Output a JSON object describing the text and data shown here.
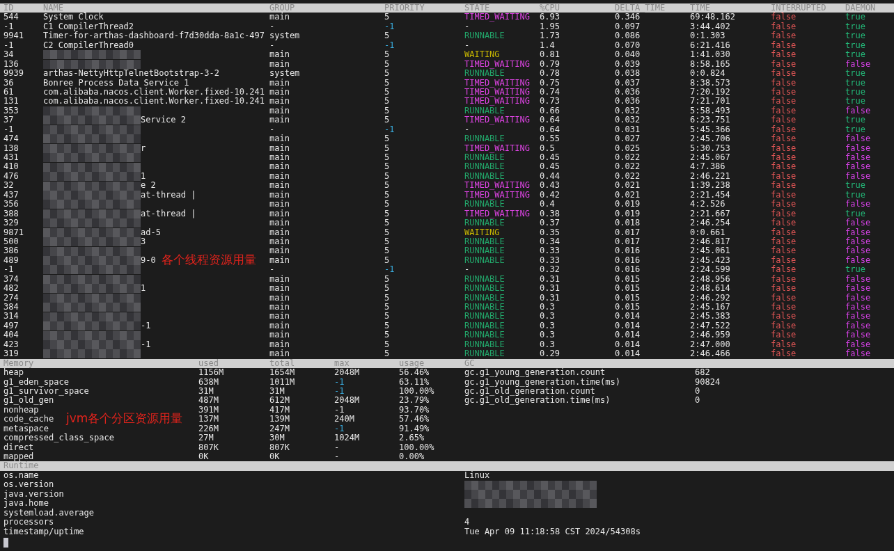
{
  "threads": {
    "columns": [
      "ID",
      "NAME",
      "GROUP",
      "PRIORITY",
      "STATE",
      "%CPU",
      "DELTA_TIME",
      "TIME",
      "INTERRUPTED",
      "DAEMON"
    ],
    "rows": [
      {
        "id": "544",
        "name": "System Clock",
        "redacted": false,
        "group": "main",
        "priority": "5",
        "internal": false,
        "state": {
          "text": "TIMED_WAITING",
          "color": "#e044e6"
        },
        "cpu": "6.93",
        "delta": "0.346",
        "time": "69:48.162",
        "interrupted": "false",
        "daemon": {
          "text": "true",
          "color": "#23b878"
        }
      },
      {
        "id": "-1",
        "name": "C1 CompilerThread2",
        "redacted": false,
        "group": "-",
        "priority": "-1",
        "internal": true,
        "state": {
          "text": "-"
        },
        "cpu": "1.95",
        "delta": "0.097",
        "time": "3:44.402",
        "interrupted": "false",
        "daemon": {
          "text": "true",
          "color": "#23b878"
        }
      },
      {
        "id": "9941",
        "name": "Timer-for-arthas-dashboard-f7d30dda-8a1c-497",
        "redacted": false,
        "group": "system",
        "priority": "5",
        "internal": false,
        "state": {
          "text": "RUNNABLE",
          "color": "#22a66a"
        },
        "cpu": "1.73",
        "delta": "0.086",
        "time": "0:1.303",
        "interrupted": "false",
        "daemon": {
          "text": "true",
          "color": "#23b878"
        }
      },
      {
        "id": "-1",
        "name": "C2 CompilerThread0",
        "redacted": false,
        "group": "-",
        "priority": "-1",
        "internal": true,
        "state": {
          "text": "-"
        },
        "cpu": "1.4",
        "delta": "0.070",
        "time": "6:21.416",
        "interrupted": "false",
        "daemon": {
          "text": "true",
          "color": "#23b878"
        }
      },
      {
        "id": "34",
        "redacted": true,
        "group": "main",
        "priority": "5",
        "internal": false,
        "state": {
          "text": "WAITING",
          "color": "#c9b800"
        },
        "cpu": "0.81",
        "delta": "0.040",
        "time": "1:41.030",
        "interrupted": "false",
        "daemon": {
          "text": "true",
          "color": "#23b878"
        }
      },
      {
        "id": "136",
        "redacted": true,
        "group": "main",
        "priority": "5",
        "internal": false,
        "state": {
          "text": "TIMED_WAITING",
          "color": "#e044e6"
        },
        "cpu": "0.79",
        "delta": "0.039",
        "time": "8:58.165",
        "interrupted": "false",
        "daemon": {
          "text": "false",
          "color": "#d040e0"
        }
      },
      {
        "id": "9939",
        "name": "arthas-NettyHttpTelnetBootstrap-3-2",
        "redacted": false,
        "group": "system",
        "priority": "5",
        "internal": false,
        "state": {
          "text": "RUNNABLE",
          "color": "#22a66a"
        },
        "cpu": "0.78",
        "delta": "0.038",
        "time": "0:0.824",
        "interrupted": "false",
        "daemon": {
          "text": "true",
          "color": "#23b878"
        }
      },
      {
        "id": "36",
        "name": "Bonree Process Data Service 1",
        "redacted": false,
        "group": "main",
        "priority": "5",
        "internal": false,
        "state": {
          "text": "TIMED_WAITING",
          "color": "#e044e6"
        },
        "cpu": "0.75",
        "delta": "0.037",
        "time": "8:38.573",
        "interrupted": "false",
        "daemon": {
          "text": "true",
          "color": "#23b878"
        }
      },
      {
        "id": "61",
        "name": "com.alibaba.nacos.client.Worker.fixed-10.241",
        "redacted": false,
        "group": "main",
        "priority": "5",
        "internal": false,
        "state": {
          "text": "TIMED_WAITING",
          "color": "#e044e6"
        },
        "cpu": "0.74",
        "delta": "0.036",
        "time": "7:20.192",
        "interrupted": "false",
        "daemon": {
          "text": "true",
          "color": "#23b878"
        }
      },
      {
        "id": "131",
        "name": "com.alibaba.nacos.client.Worker.fixed-10.241",
        "redacted": false,
        "group": "main",
        "priority": "5",
        "internal": false,
        "state": {
          "text": "TIMED_WAITING",
          "color": "#e044e6"
        },
        "cpu": "0.73",
        "delta": "0.036",
        "time": "7:21.701",
        "interrupted": "false",
        "daemon": {
          "text": "true",
          "color": "#23b878"
        }
      },
      {
        "id": "353",
        "redacted": true,
        "group": "main",
        "priority": "5",
        "internal": false,
        "state": {
          "text": "RUNNABLE",
          "color": "#22a66a"
        },
        "cpu": "0.66",
        "delta": "0.032",
        "time": "5:58.493",
        "interrupted": "false",
        "daemon": {
          "text": "false",
          "color": "#d040e0"
        }
      },
      {
        "id": "37",
        "name": "Service 2",
        "redacted": true,
        "group": "main",
        "priority": "5",
        "internal": false,
        "state": {
          "text": "TIMED_WAITING",
          "color": "#e044e6"
        },
        "cpu": "0.64",
        "delta": "0.032",
        "time": "6:23.751",
        "interrupted": "false",
        "daemon": {
          "text": "true",
          "color": "#23b878"
        }
      },
      {
        "id": "-1",
        "redacted": true,
        "group": "-",
        "priority": "-1",
        "internal": true,
        "state": {
          "text": "-"
        },
        "cpu": "0.64",
        "delta": "0.031",
        "time": "5:45.366",
        "interrupted": "false",
        "daemon": {
          "text": "true",
          "color": "#23b878"
        }
      },
      {
        "id": "474",
        "redacted": true,
        "group": "main",
        "priority": "5",
        "internal": false,
        "state": {
          "text": "RUNNABLE",
          "color": "#22a66a"
        },
        "cpu": "0.55",
        "delta": "0.027",
        "time": "2:45.706",
        "interrupted": "false",
        "daemon": {
          "text": "false",
          "color": "#d040e0"
        }
      },
      {
        "id": "138",
        "name": "r",
        "redacted": true,
        "group": "main",
        "priority": "5",
        "internal": false,
        "state": {
          "text": "TIMED_WAITING",
          "color": "#e044e6"
        },
        "cpu": "0.5",
        "delta": "0.025",
        "time": "5:30.753",
        "interrupted": "false",
        "daemon": {
          "text": "false",
          "color": "#d040e0"
        }
      },
      {
        "id": "431",
        "redacted": true,
        "group": "main",
        "priority": "5",
        "internal": false,
        "state": {
          "text": "RUNNABLE",
          "color": "#22a66a"
        },
        "cpu": "0.45",
        "delta": "0.022",
        "time": "2:45.067",
        "interrupted": "false",
        "daemon": {
          "text": "false",
          "color": "#d040e0"
        }
      },
      {
        "id": "410",
        "redacted": true,
        "group": "main",
        "priority": "5",
        "internal": false,
        "state": {
          "text": "RUNNABLE",
          "color": "#22a66a"
        },
        "cpu": "0.45",
        "delta": "0.022",
        "time": "4:7.386",
        "interrupted": "false",
        "daemon": {
          "text": "false",
          "color": "#d040e0"
        }
      },
      {
        "id": "476",
        "name": "1",
        "redacted": true,
        "group": "main",
        "priority": "5",
        "internal": false,
        "state": {
          "text": "RUNNABLE",
          "color": "#22a66a"
        },
        "cpu": "0.44",
        "delta": "0.022",
        "time": "2:46.221",
        "interrupted": "false",
        "daemon": {
          "text": "false",
          "color": "#d040e0"
        }
      },
      {
        "id": "32",
        "name": "e 2",
        "redacted": true,
        "group": "main",
        "priority": "5",
        "internal": false,
        "state": {
          "text": "TIMED_WAITING",
          "color": "#e044e6"
        },
        "cpu": "0.43",
        "delta": "0.021",
        "time": "1:39.238",
        "interrupted": "false",
        "daemon": {
          "text": "true",
          "color": "#23b878"
        }
      },
      {
        "id": "437",
        "name": "at-thread |",
        "redacted": true,
        "group": "main",
        "priority": "5",
        "internal": false,
        "state": {
          "text": "TIMED_WAITING",
          "color": "#e044e6"
        },
        "cpu": "0.42",
        "delta": "0.021",
        "time": "2:21.454",
        "interrupted": "false",
        "daemon": {
          "text": "true",
          "color": "#23b878"
        }
      },
      {
        "id": "356",
        "redacted": true,
        "group": "main",
        "priority": "5",
        "internal": false,
        "state": {
          "text": "RUNNABLE",
          "color": "#22a66a"
        },
        "cpu": "0.4",
        "delta": "0.019",
        "time": "4:2.526",
        "interrupted": "false",
        "daemon": {
          "text": "false",
          "color": "#d040e0"
        }
      },
      {
        "id": "388",
        "name": "at-thread |",
        "redacted": true,
        "group": "main",
        "priority": "5",
        "internal": false,
        "state": {
          "text": "TIMED_WAITING",
          "color": "#e044e6"
        },
        "cpu": "0.38",
        "delta": "0.019",
        "time": "2:21.667",
        "interrupted": "false",
        "daemon": {
          "text": "true",
          "color": "#23b878"
        }
      },
      {
        "id": "329",
        "redacted": true,
        "group": "main",
        "priority": "5",
        "internal": false,
        "state": {
          "text": "RUNNABLE",
          "color": "#22a66a"
        },
        "cpu": "0.37",
        "delta": "0.018",
        "time": "2:46.254",
        "interrupted": "false",
        "daemon": {
          "text": "false",
          "color": "#d040e0"
        }
      },
      {
        "id": "9871",
        "name": "ad-5",
        "redacted": true,
        "group": "main",
        "priority": "5",
        "internal": false,
        "state": {
          "text": "WAITING",
          "color": "#c9b800"
        },
        "cpu": "0.35",
        "delta": "0.017",
        "time": "0:0.661",
        "interrupted": "false",
        "daemon": {
          "text": "false",
          "color": "#d040e0"
        }
      },
      {
        "id": "500",
        "name": "3",
        "redacted": true,
        "group": "main",
        "priority": "5",
        "internal": false,
        "state": {
          "text": "RUNNABLE",
          "color": "#22a66a"
        },
        "cpu": "0.34",
        "delta": "0.017",
        "time": "2:46.817",
        "interrupted": "false",
        "daemon": {
          "text": "false",
          "color": "#d040e0"
        }
      },
      {
        "id": "386",
        "redacted": true,
        "group": "main",
        "priority": "5",
        "internal": false,
        "state": {
          "text": "RUNNABLE",
          "color": "#22a66a"
        },
        "cpu": "0.33",
        "delta": "0.016",
        "time": "2:45.061",
        "interrupted": "false",
        "daemon": {
          "text": "false",
          "color": "#d040e0"
        }
      },
      {
        "id": "489",
        "name": "9-0",
        "redacted": true,
        "group": "main",
        "priority": "5",
        "internal": false,
        "state": {
          "text": "RUNNABLE",
          "color": "#22a66a"
        },
        "cpu": "0.33",
        "delta": "0.016",
        "time": "2:45.423",
        "interrupted": "false",
        "daemon": {
          "text": "false",
          "color": "#d040e0"
        }
      },
      {
        "id": "-1",
        "redacted": true,
        "group": "-",
        "priority": "-1",
        "internal": true,
        "state": {
          "text": "-"
        },
        "cpu": "0.32",
        "delta": "0.016",
        "time": "2:24.599",
        "interrupted": "false",
        "daemon": {
          "text": "true",
          "color": "#23b878"
        }
      },
      {
        "id": "374",
        "redacted": true,
        "group": "main",
        "priority": "5",
        "internal": false,
        "state": {
          "text": "RUNNABLE",
          "color": "#22a66a"
        },
        "cpu": "0.31",
        "delta": "0.015",
        "time": "2:48.956",
        "interrupted": "false",
        "daemon": {
          "text": "false",
          "color": "#d040e0"
        }
      },
      {
        "id": "482",
        "name": "1",
        "redacted": true,
        "group": "main",
        "priority": "5",
        "internal": false,
        "state": {
          "text": "RUNNABLE",
          "color": "#22a66a"
        },
        "cpu": "0.31",
        "delta": "0.015",
        "time": "2:48.614",
        "interrupted": "false",
        "daemon": {
          "text": "false",
          "color": "#d040e0"
        }
      },
      {
        "id": "274",
        "redacted": true,
        "group": "main",
        "priority": "5",
        "internal": false,
        "state": {
          "text": "RUNNABLE",
          "color": "#22a66a"
        },
        "cpu": "0.31",
        "delta": "0.015",
        "time": "2:46.292",
        "interrupted": "false",
        "daemon": {
          "text": "false",
          "color": "#d040e0"
        }
      },
      {
        "id": "384",
        "redacted": true,
        "group": "main",
        "priority": "5",
        "internal": false,
        "state": {
          "text": "RUNNABLE",
          "color": "#22a66a"
        },
        "cpu": "0.3",
        "delta": "0.015",
        "time": "2:45.167",
        "interrupted": "false",
        "daemon": {
          "text": "false",
          "color": "#d040e0"
        }
      },
      {
        "id": "314",
        "redacted": true,
        "group": "main",
        "priority": "5",
        "internal": false,
        "state": {
          "text": "RUNNABLE",
          "color": "#22a66a"
        },
        "cpu": "0.3",
        "delta": "0.014",
        "time": "2:45.383",
        "interrupted": "false",
        "daemon": {
          "text": "false",
          "color": "#d040e0"
        }
      },
      {
        "id": "497",
        "name": "-1",
        "redacted": true,
        "group": "main",
        "priority": "5",
        "internal": false,
        "state": {
          "text": "RUNNABLE",
          "color": "#22a66a"
        },
        "cpu": "0.3",
        "delta": "0.014",
        "time": "2:47.522",
        "interrupted": "false",
        "daemon": {
          "text": "false",
          "color": "#d040e0"
        }
      },
      {
        "id": "404",
        "redacted": true,
        "group": "main",
        "priority": "5",
        "internal": false,
        "state": {
          "text": "RUNNABLE",
          "color": "#22a66a"
        },
        "cpu": "0.3",
        "delta": "0.014",
        "time": "2:46.959",
        "interrupted": "false",
        "daemon": {
          "text": "false",
          "color": "#d040e0"
        }
      },
      {
        "id": "423",
        "name": "-1",
        "redacted": true,
        "group": "main",
        "priority": "5",
        "internal": false,
        "state": {
          "text": "RUNNABLE",
          "color": "#22a66a"
        },
        "cpu": "0.3",
        "delta": "0.014",
        "time": "2:47.000",
        "interrupted": "false",
        "daemon": {
          "text": "false",
          "color": "#d040e0"
        }
      },
      {
        "id": "319",
        "redacted": true,
        "group": "main",
        "priority": "5",
        "internal": false,
        "state": {
          "text": "RUNNABLE",
          "color": "#22a66a"
        },
        "cpu": "0.29",
        "delta": "0.014",
        "time": "2:46.466",
        "interrupted": "false",
        "daemon": {
          "text": "false",
          "color": "#d040e0"
        }
      }
    ],
    "annotation": "各个线程资源用量"
  },
  "memory": {
    "columns": [
      "Memory",
      "used",
      "total",
      "max",
      "usage"
    ],
    "rows": [
      {
        "name": "heap",
        "used": "1156M",
        "total": "1654M",
        "max": "2048M",
        "max_marked": false,
        "usage": "56.46%"
      },
      {
        "name": "g1_eden_space",
        "used": "638M",
        "total": "1011M",
        "max": "-1",
        "max_marked": true,
        "usage": "63.11%"
      },
      {
        "name": "g1_survivor_space",
        "used": "31M",
        "total": "31M",
        "max": "-1",
        "max_marked": true,
        "usage": "100.00%"
      },
      {
        "name": "g1_old_gen",
        "used": "487M",
        "total": "612M",
        "max": "2048M",
        "max_marked": false,
        "usage": "23.79%"
      },
      {
        "name": "nonheap",
        "used": "391M",
        "total": "417M",
        "max": "-1",
        "max_marked": false,
        "usage": "93.70%"
      },
      {
        "name": "code_cache",
        "used": "137M",
        "total": "139M",
        "max": "240M",
        "max_marked": false,
        "usage": "57.46%"
      },
      {
        "name": "metaspace",
        "used": "226M",
        "total": "247M",
        "max": "-1",
        "max_marked": true,
        "usage": "91.49%"
      },
      {
        "name": "compressed_class_space",
        "used": "27M",
        "total": "30M",
        "max": "1024M",
        "max_marked": false,
        "usage": "2.65%"
      },
      {
        "name": "direct",
        "used": "807K",
        "total": "807K",
        "max": "-",
        "max_marked": false,
        "usage": "100.00%"
      },
      {
        "name": "mapped",
        "used": "0K",
        "total": "0K",
        "max": "-",
        "max_marked": false,
        "usage": "0.00%"
      }
    ],
    "annotation": "jvm各个分区资源用量"
  },
  "gc": {
    "title": "GC",
    "rows": [
      {
        "key": "gc.g1_young_generation.count",
        "value": "682"
      },
      {
        "key": "gc.g1_young_generation.time(ms)",
        "value": "90824"
      },
      {
        "key": "gc.g1_old_generation.count",
        "value": "0"
      },
      {
        "key": "gc.g1_old_generation.time(ms)",
        "value": "0"
      }
    ]
  },
  "runtime": {
    "title": "Runtime",
    "rows": [
      {
        "key": "os.name",
        "value": "Linux",
        "redacted": false
      },
      {
        "key": "os.version",
        "redacted": true
      },
      {
        "key": "java.version",
        "redacted": true
      },
      {
        "key": "java.home",
        "redacted": true
      },
      {
        "key": "systemload.average",
        "redacted": false
      },
      {
        "key": "processors",
        "value": "4",
        "redacted": false
      },
      {
        "key": "timestamp/uptime",
        "value": "Tue Apr 09 11:18:58 CST 2024/54308s",
        "redacted": false
      }
    ]
  }
}
